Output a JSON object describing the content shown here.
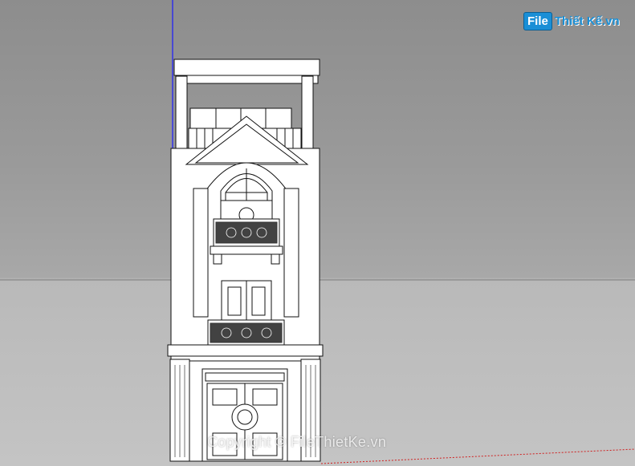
{
  "app": {
    "background_sky": "#8d8d8d",
    "background_ground": "#bdbdbd",
    "axis_blue": "#1a1aff",
    "axis_red": "#d02020",
    "building_fill": "#ffffff",
    "line_color": "#111111"
  },
  "logo": {
    "box_text": "File",
    "rest_text": "Thiết Kế.vn",
    "brand_color": "#1a8fd6"
  },
  "watermark": {
    "text": "Copyright © FileThietKe.vn"
  }
}
